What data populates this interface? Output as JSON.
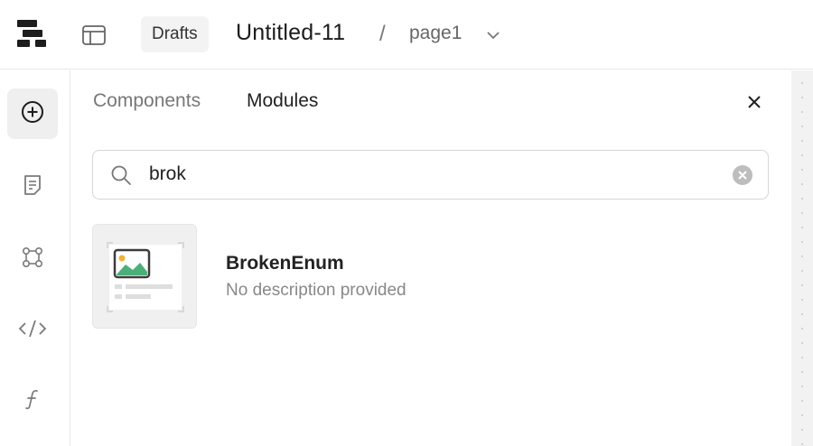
{
  "header": {
    "drafts_label": "Drafts",
    "file_title": "Untitled-11",
    "separator": "/",
    "page_name": "page1"
  },
  "sidebar": {
    "items": [
      {
        "icon": "add-circle-icon",
        "active": true
      },
      {
        "icon": "note-icon",
        "active": false
      },
      {
        "icon": "nodes-icon",
        "active": false
      },
      {
        "icon": "code-icon",
        "active": false
      },
      {
        "icon": "function-icon",
        "active": false
      }
    ]
  },
  "panel": {
    "tabs": [
      {
        "label": "Components",
        "active": false
      },
      {
        "label": "Modules",
        "active": true
      }
    ],
    "search": {
      "value": "brok"
    },
    "results": [
      {
        "name": "BrokenEnum",
        "description": "No description provided"
      }
    ]
  },
  "colors": {
    "thumb_image_green": "#4caf7a",
    "thumb_image_sun": "#f2b233",
    "icon_dark": "#1d1d1d",
    "icon_muted": "#7a7a7a"
  }
}
